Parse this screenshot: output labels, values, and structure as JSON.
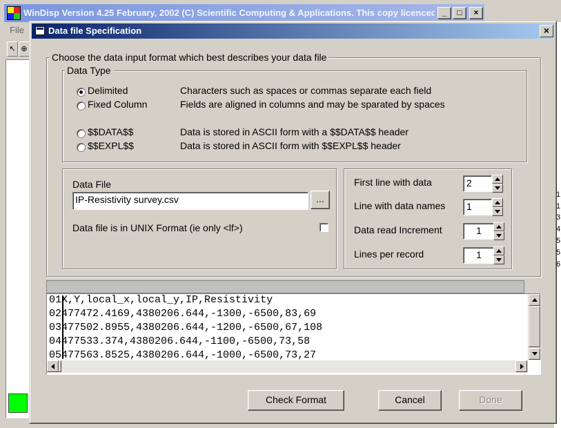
{
  "background_app": {
    "title": "WinDisp Version 4.25 February, 2002 (C) Scientific Computing & Applications. This copy licenced to thom...",
    "menu_file": "File",
    "minimize_glyph": "_",
    "maximize_glyph": "□",
    "close_glyph": "×",
    "row_numbers": [
      "1",
      "1",
      "3",
      "4",
      "5",
      "5",
      "6"
    ]
  },
  "dialog": {
    "title": "Data file Specification",
    "close_glyph": "×",
    "format_group_label": "Choose the data input format which best describes your data file",
    "data_type": {
      "label": "Data Type",
      "options": [
        {
          "name": "Delimited",
          "description": "Characters such as spaces or commas separate each field",
          "selected": true
        },
        {
          "name": "Fixed Column",
          "description": "Fields are aligned in columns and may be sparated by spaces",
          "selected": false
        },
        {
          "name": "$$DATA$$",
          "description": "Data is stored in ASCII form with a $$DATA$$ header",
          "selected": false
        },
        {
          "name": "$$EXPL$$",
          "description": "Data is stored in ASCII form with $$EXPL$$ header",
          "selected": false
        }
      ]
    },
    "data_file": {
      "label": "Data File",
      "value": "IP-Resistivity survey.csv",
      "browse_label": "...",
      "unix_label": "Data file is in UNIX Format (ie only <lf>)",
      "unix_checked": false
    },
    "settings": {
      "first_line_label": "First line with data",
      "first_line_value": "2",
      "names_line_label": "Line with data names",
      "names_line_value": "1",
      "increment_label": "Data read Increment",
      "increment_value": "1",
      "lines_per_record_label": "Lines per record",
      "lines_per_record_value": "1"
    },
    "preview": {
      "lines": [
        {
          "num": "01",
          "text": "X,Y,local_x,local_y,IP,Resistivity"
        },
        {
          "num": "02",
          "text": "477472.4169,4380206.644,-1300,-6500,83,69"
        },
        {
          "num": "03",
          "text": "477502.8955,4380206.644,-1200,-6500,67,108"
        },
        {
          "num": "04",
          "text": "477533.374,4380206.644,-1100,-6500,73,58"
        },
        {
          "num": "05",
          "text": "477563.8525,4380206.644,-1000,-6500,73,27"
        }
      ]
    },
    "buttons": {
      "check_format": "Check Format",
      "cancel": "Cancel",
      "done": "Done"
    }
  }
}
